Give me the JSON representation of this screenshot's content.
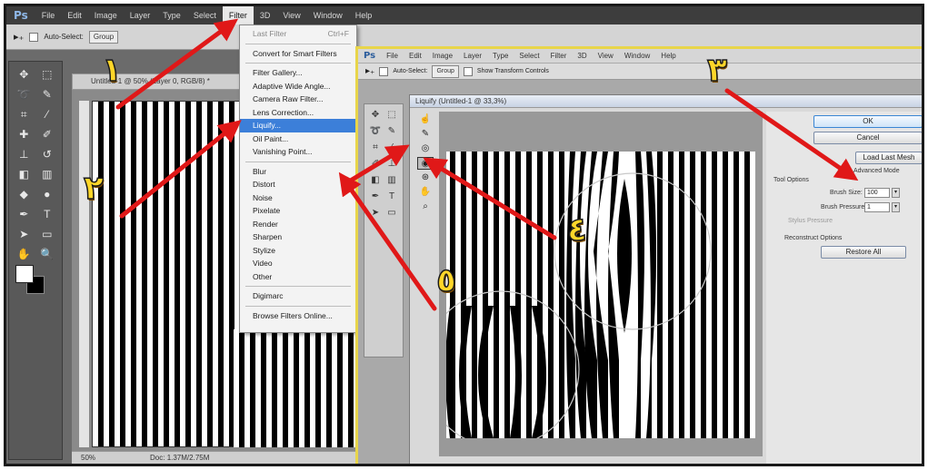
{
  "main_window": {
    "logo": "Ps",
    "menus": [
      "File",
      "Edit",
      "Image",
      "Layer",
      "Type",
      "Select",
      "Filter",
      "3D",
      "View",
      "Window",
      "Help"
    ],
    "active_menu": "Filter",
    "options": {
      "auto_select": "Auto-Select:",
      "group": "Group"
    },
    "doc_tab": "Untitled-1 @ 50% (Layer 0, RGB/8) *",
    "status_zoom": "50%",
    "status_doc": "Doc: 1.37M/2.75M"
  },
  "filter_menu": {
    "items": [
      {
        "label": "Last Filter",
        "shortcut": "Ctrl+F",
        "disabled": true
      },
      {
        "sep": true
      },
      {
        "label": "Convert for Smart Filters"
      },
      {
        "sep": true
      },
      {
        "label": "Filter Gallery..."
      },
      {
        "label": "Adaptive Wide Angle..."
      },
      {
        "label": "Camera Raw Filter..."
      },
      {
        "label": "Lens Correction..."
      },
      {
        "label": "Liquify...",
        "selected": true
      },
      {
        "label": "Oil Paint..."
      },
      {
        "label": "Vanishing Point..."
      },
      {
        "sep": true
      },
      {
        "label": "Blur"
      },
      {
        "label": "Distort"
      },
      {
        "label": "Noise"
      },
      {
        "label": "Pixelate"
      },
      {
        "label": "Render"
      },
      {
        "label": "Sharpen"
      },
      {
        "label": "Stylize"
      },
      {
        "label": "Video"
      },
      {
        "label": "Other"
      },
      {
        "sep": true
      },
      {
        "label": "Digimarc"
      },
      {
        "sep": true
      },
      {
        "label": "Browse Filters Online..."
      }
    ]
  },
  "second_window": {
    "logo": "Ps",
    "menus": [
      "File",
      "Edit",
      "Image",
      "Layer",
      "Type",
      "Select",
      "Filter",
      "3D",
      "View",
      "Window",
      "Help"
    ],
    "options": {
      "auto_select": "Auto-Select:",
      "group": "Group",
      "transform": "Show Transform Controls"
    }
  },
  "liquify": {
    "title": "Liquify (Untitled-1 @ 33,3%)",
    "buttons": {
      "ok": "OK",
      "cancel": "Cancel",
      "load_last": "Load Last Mesh",
      "restore_all": "Restore All"
    },
    "advanced_mode": "Advanced Mode",
    "tool_options": "Tool Options",
    "brush_size_label": "Brush Size:",
    "brush_size_value": "100",
    "brush_pressure_label": "Brush Pressure:",
    "brush_pressure_value": "1",
    "stylus_pressure": "Stylus Pressure",
    "reconstruct_options": "Reconstruct Options"
  },
  "annotations": [
    "١",
    "٢",
    "٣",
    "٤",
    "٥"
  ],
  "colors": {
    "arrow": "#e01818",
    "badge": "#ffd629",
    "highlight_frame": "#e8d54a",
    "selection": "#3c7fd9"
  }
}
